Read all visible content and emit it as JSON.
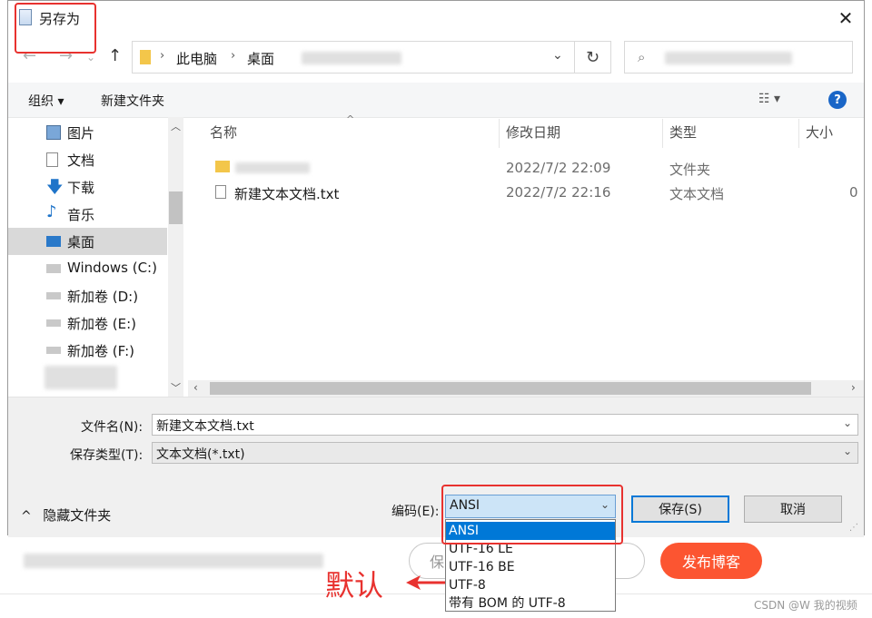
{
  "dialog": {
    "title": "另存为",
    "breadcrumb": [
      "此电脑",
      "桌面"
    ],
    "toolbar": {
      "organize": "组织 ▾",
      "new_folder": "新建文件夹",
      "help": "?"
    },
    "nav": [
      {
        "label": "图片",
        "icon": "pictures-icon"
      },
      {
        "label": "文档",
        "icon": "documents-icon"
      },
      {
        "label": "下载",
        "icon": "download-icon"
      },
      {
        "label": "音乐",
        "icon": "music-icon"
      },
      {
        "label": "桌面",
        "icon": "desktop-icon",
        "selected": true
      },
      {
        "label": "Windows (C:)",
        "icon": "windows-drive-icon"
      },
      {
        "label": "新加卷 (D:)",
        "icon": "drive-icon"
      },
      {
        "label": "新加卷 (E:)",
        "icon": "drive-icon"
      },
      {
        "label": "新加卷 (F:)",
        "icon": "drive-icon"
      }
    ],
    "columns": [
      "名称",
      "修改日期",
      "类型",
      "大小"
    ],
    "files": [
      {
        "name": "",
        "date": "2022/7/2 22:09",
        "type": "文件夹",
        "size": ""
      },
      {
        "name": "新建文本文档.txt",
        "date": "2022/7/2 22:16",
        "type": "文本文档",
        "size": "0"
      }
    ],
    "filename_label": "文件名(N):",
    "filename_value": "新建文本文档.txt",
    "filetype_label": "保存类型(T):",
    "filetype_value": "文本文档(*.txt)",
    "hide_folders": "隐藏文件夹",
    "encoding_label": "编码(E):",
    "encoding_value": "ANSI",
    "encoding_options": [
      "ANSI",
      "UTF-16 LE",
      "UTF-16 BE",
      "UTF-8",
      "带有 BOM 的 UTF-8"
    ],
    "save_button": "保存(S)",
    "cancel_button": "取消"
  },
  "background": {
    "publish_button": "发布博客",
    "save_partial": "保",
    "annotation": "默认",
    "watermark": "CSDN @W 我的视频"
  },
  "colors": {
    "accent": "#0078d7",
    "annotation_red": "#e8322f",
    "publish": "#fc5531"
  }
}
